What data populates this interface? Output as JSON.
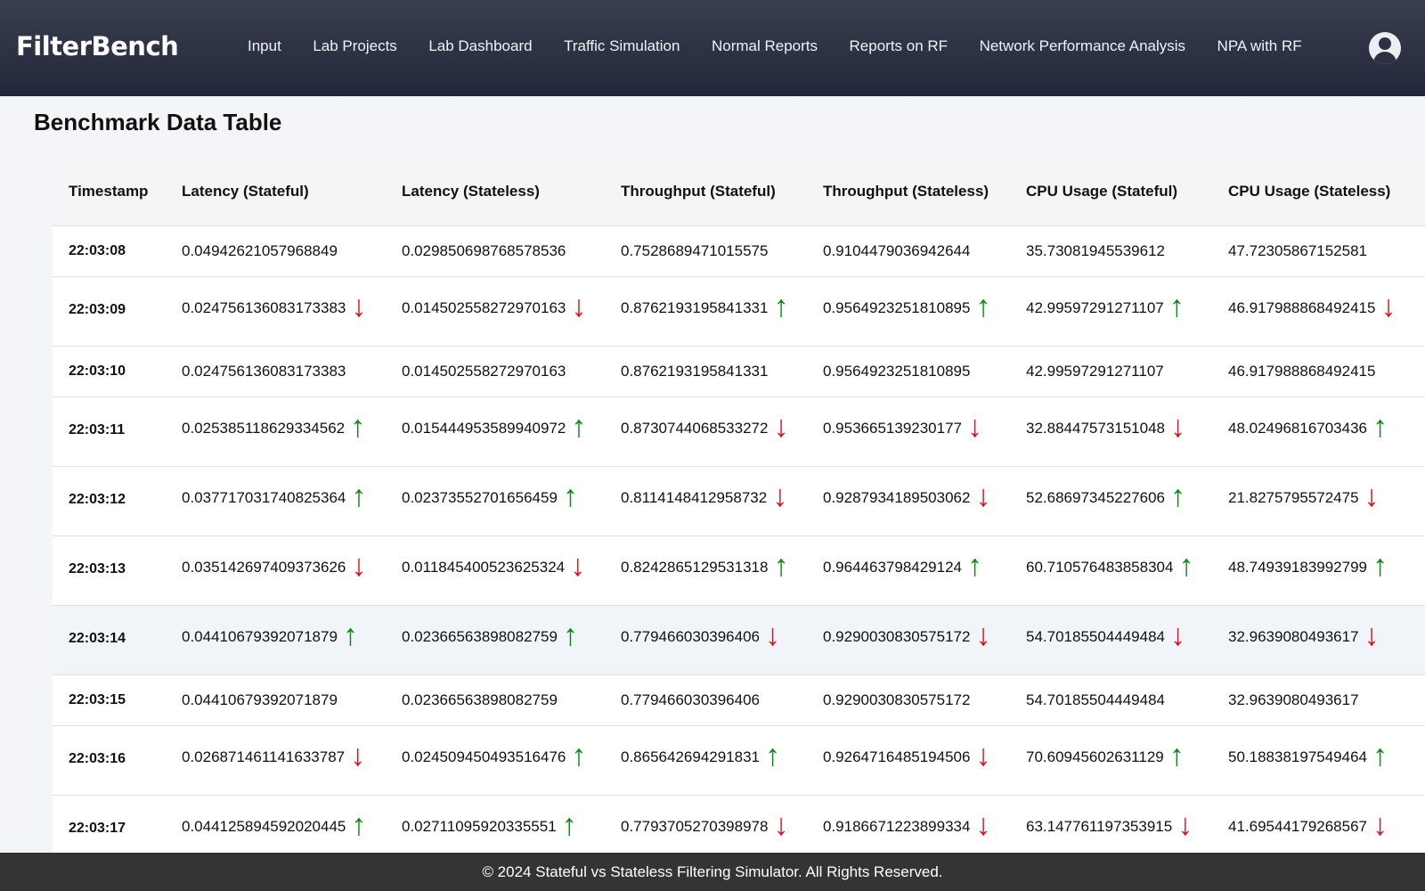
{
  "app": {
    "brand": "FilterBench"
  },
  "nav": {
    "items": [
      {
        "label": "Input"
      },
      {
        "label": "Lab Projects"
      },
      {
        "label": "Lab Dashboard"
      },
      {
        "label": "Traffic Simulation"
      },
      {
        "label": "Normal Reports"
      },
      {
        "label": "Reports on RF"
      },
      {
        "label": "Network Performance Analysis"
      },
      {
        "label": "NPA with RF"
      }
    ],
    "avatar_icon": "user-circle-icon"
  },
  "page": {
    "title": "Benchmark Data Table"
  },
  "table": {
    "headers": [
      "Timestamp",
      "Latency (Stateful)",
      "Latency (Stateless)",
      "Throughput (Stateful)",
      "Throughput (Stateless)",
      "CPU Usage (Stateful)",
      "CPU Usage (Stateless)"
    ],
    "rows": [
      {
        "ts": "22:03:08",
        "cells": [
          {
            "v": "0.04942621057968849",
            "t": ""
          },
          {
            "v": "0.029850698768578536",
            "t": ""
          },
          {
            "v": "0.7528689471015575",
            "t": ""
          },
          {
            "v": "0.9104479036942644",
            "t": ""
          },
          {
            "v": "35.73081945539612",
            "t": ""
          },
          {
            "v": "47.72305867152581",
            "t": ""
          }
        ]
      },
      {
        "ts": "22:03:09",
        "cells": [
          {
            "v": "0.024756136083173383",
            "t": "down"
          },
          {
            "v": "0.014502558272970163",
            "t": "down"
          },
          {
            "v": "0.8762193195841331",
            "t": "up"
          },
          {
            "v": "0.9564923251810895",
            "t": "up"
          },
          {
            "v": "42.99597291271107",
            "t": "up"
          },
          {
            "v": "46.917988868492415",
            "t": "down"
          }
        ]
      },
      {
        "ts": "22:03:10",
        "cells": [
          {
            "v": "0.024756136083173383",
            "t": ""
          },
          {
            "v": "0.014502558272970163",
            "t": ""
          },
          {
            "v": "0.8762193195841331",
            "t": ""
          },
          {
            "v": "0.9564923251810895",
            "t": ""
          },
          {
            "v": "42.99597291271107",
            "t": ""
          },
          {
            "v": "46.917988868492415",
            "t": ""
          }
        ]
      },
      {
        "ts": "22:03:11",
        "cells": [
          {
            "v": "0.025385118629334562",
            "t": "up"
          },
          {
            "v": "0.015444953589940972",
            "t": "up"
          },
          {
            "v": "0.8730744068533272",
            "t": "down"
          },
          {
            "v": "0.953665139230177",
            "t": "down"
          },
          {
            "v": "32.88447573151048",
            "t": "down"
          },
          {
            "v": "48.02496816703436",
            "t": "up"
          }
        ]
      },
      {
        "ts": "22:03:12",
        "cells": [
          {
            "v": "0.037717031740825364",
            "t": "up"
          },
          {
            "v": "0.02373552701656459",
            "t": "up"
          },
          {
            "v": "0.8114148412958732",
            "t": "down"
          },
          {
            "v": "0.9287934189503062",
            "t": "down"
          },
          {
            "v": "52.68697345227606",
            "t": "up"
          },
          {
            "v": "21.8275795572475",
            "t": "down"
          }
        ]
      },
      {
        "ts": "22:03:13",
        "cells": [
          {
            "v": "0.035142697409373626",
            "t": "down"
          },
          {
            "v": "0.011845400523625324",
            "t": "down"
          },
          {
            "v": "0.8242865129531318",
            "t": "up"
          },
          {
            "v": "0.964463798429124",
            "t": "up"
          },
          {
            "v": "60.710576483858304",
            "t": "up"
          },
          {
            "v": "48.74939183992799",
            "t": "up"
          }
        ]
      },
      {
        "ts": "22:03:14",
        "hl": true,
        "cells": [
          {
            "v": "0.04410679392071879",
            "t": "up"
          },
          {
            "v": "0.02366563898082759",
            "t": "up"
          },
          {
            "v": "0.779466030396406",
            "t": "down"
          },
          {
            "v": "0.9290030830575172",
            "t": "down"
          },
          {
            "v": "54.70185504449484",
            "t": "down"
          },
          {
            "v": "32.9639080493617",
            "t": "down"
          }
        ]
      },
      {
        "ts": "22:03:15",
        "cells": [
          {
            "v": "0.04410679392071879",
            "t": ""
          },
          {
            "v": "0.02366563898082759",
            "t": ""
          },
          {
            "v": "0.779466030396406",
            "t": ""
          },
          {
            "v": "0.9290030830575172",
            "t": ""
          },
          {
            "v": "54.70185504449484",
            "t": ""
          },
          {
            "v": "32.9639080493617",
            "t": ""
          }
        ]
      },
      {
        "ts": "22:03:16",
        "cells": [
          {
            "v": "0.026871461141633787",
            "t": "down"
          },
          {
            "v": "0.024509450493516476",
            "t": "up"
          },
          {
            "v": "0.865642694291831",
            "t": "up"
          },
          {
            "v": "0.9264716485194506",
            "t": "down"
          },
          {
            "v": "70.60945602631129",
            "t": "up"
          },
          {
            "v": "50.18838197549464",
            "t": "up"
          }
        ]
      },
      {
        "ts": "22:03:17",
        "cells": [
          {
            "v": "0.044125894592020445",
            "t": "up"
          },
          {
            "v": "0.02711095920335551",
            "t": "up"
          },
          {
            "v": "0.7793705270398978",
            "t": "down"
          },
          {
            "v": "0.9186671223899334",
            "t": "down"
          },
          {
            "v": "63.147761197353915",
            "t": "down"
          },
          {
            "v": "41.69544179268567",
            "t": "down"
          }
        ]
      }
    ],
    "arrow_glyphs": {
      "up": "↑",
      "down": "↓"
    },
    "colors": {
      "up": "#0a8a12",
      "down": "#e0101a"
    }
  },
  "footer": {
    "text": "© 2024 Stateful vs Stateless Filtering Simulator. All Rights Reserved."
  }
}
